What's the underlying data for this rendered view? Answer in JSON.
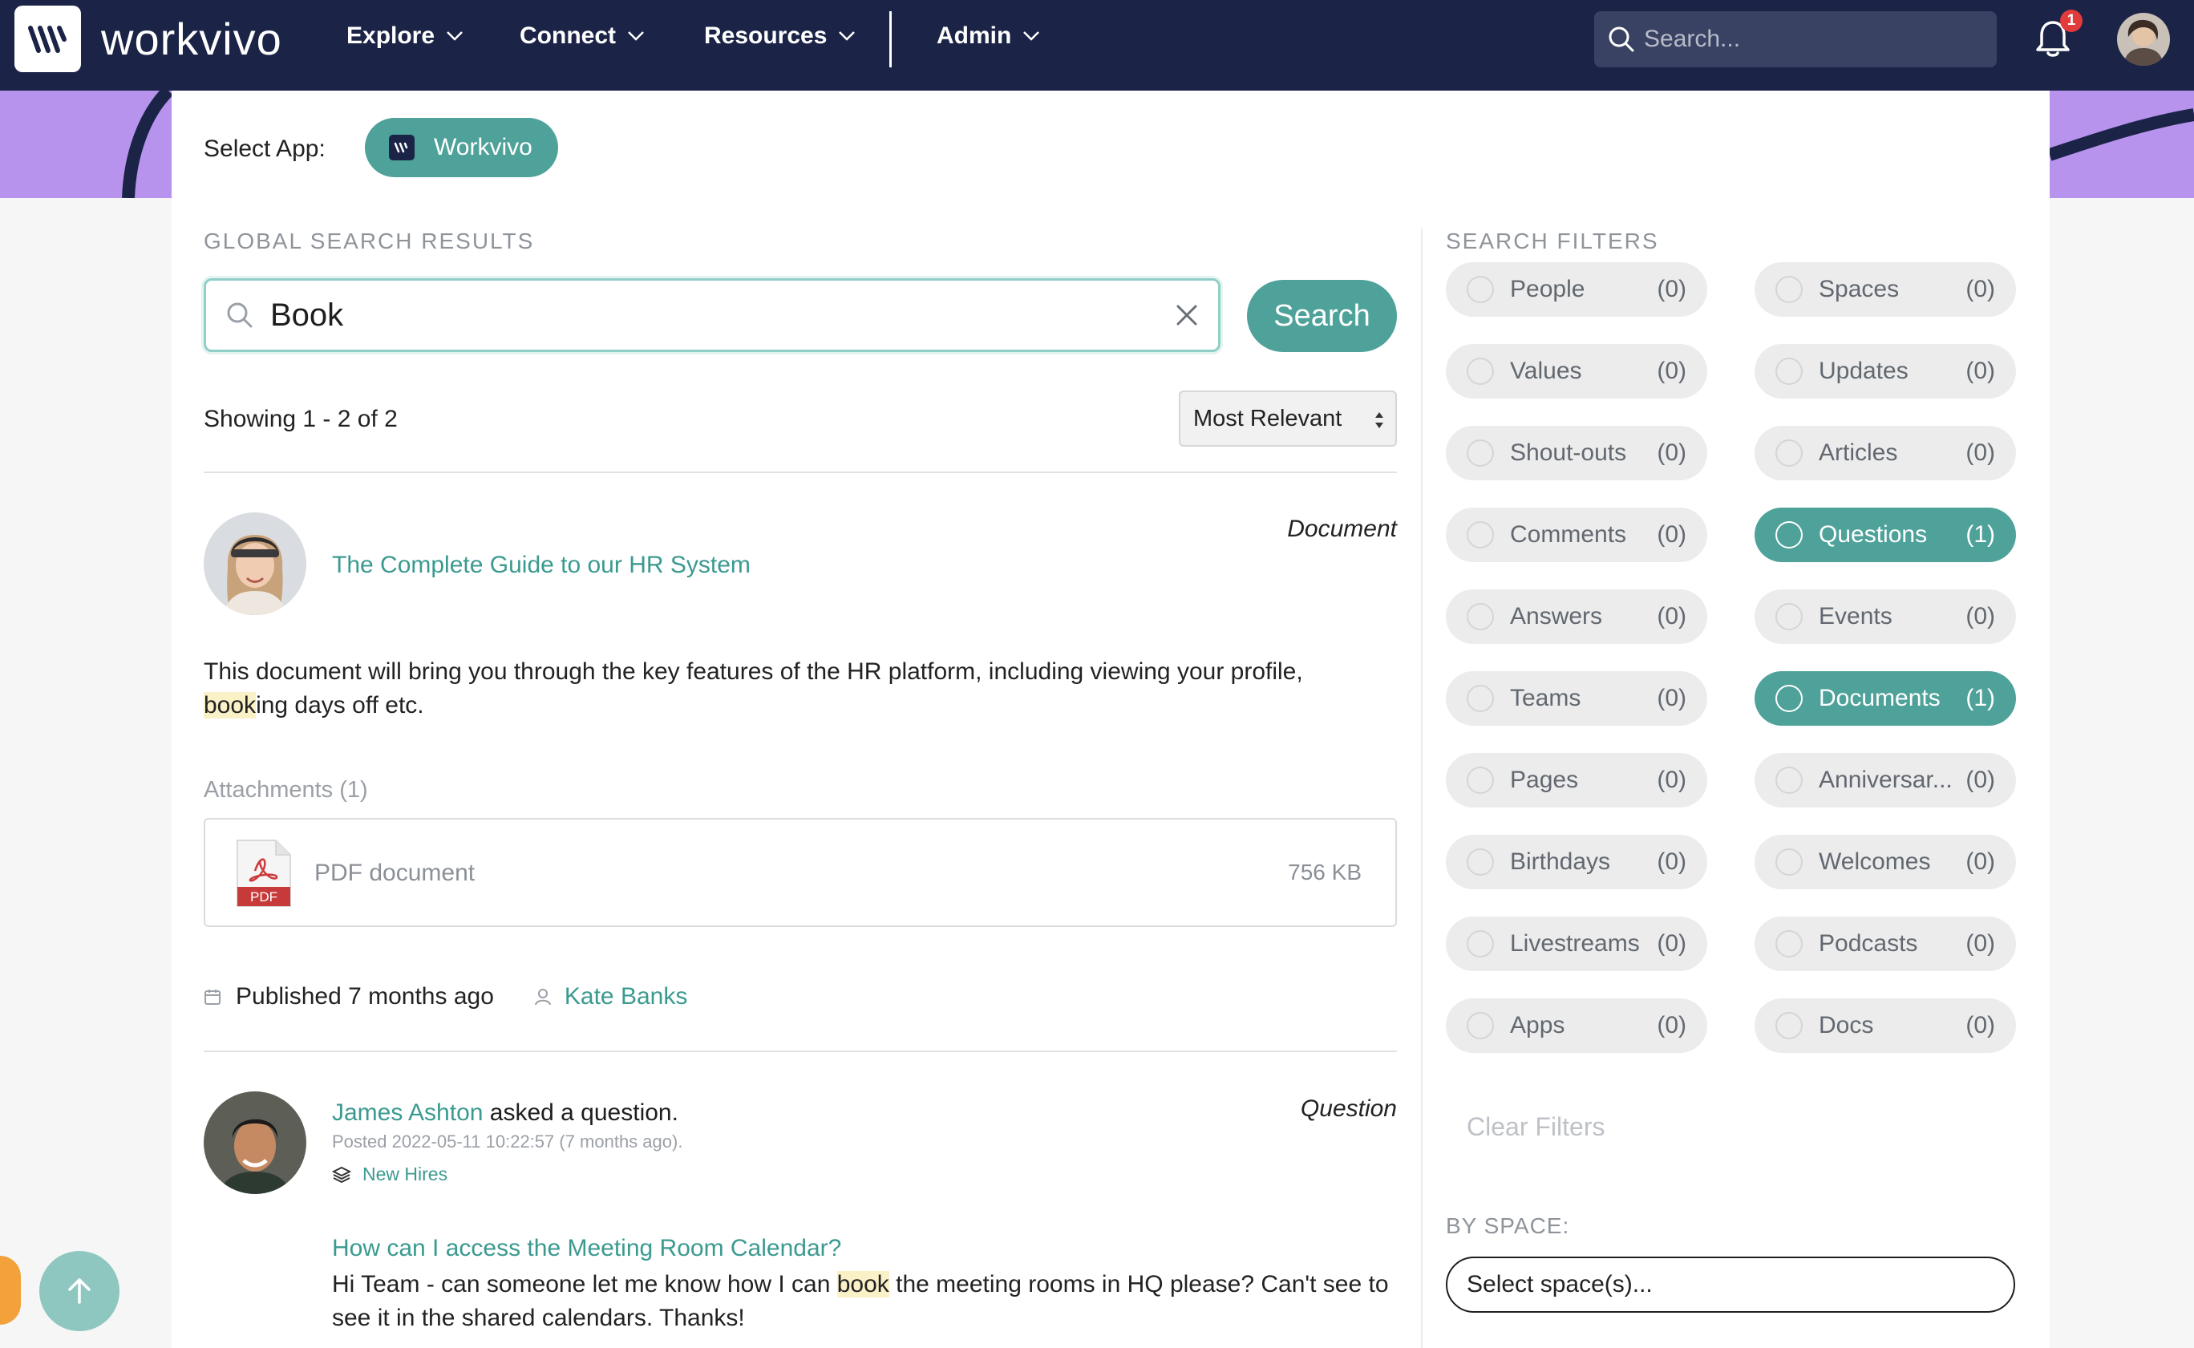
{
  "nav": {
    "brand": "workvivo",
    "items": [
      {
        "label": "Explore"
      },
      {
        "label": "Connect"
      },
      {
        "label": "Resources"
      },
      {
        "label": "Admin"
      }
    ],
    "search_placeholder": "Search...",
    "notifications_count": "1"
  },
  "app_select": {
    "label": "Select App:",
    "selected": "Workvivo"
  },
  "results": {
    "section_title": "GLOBAL SEARCH RESULTS",
    "query": "Book",
    "search_button": "Search",
    "showing": "Showing 1 - 2 of 2",
    "sort": "Most Relevant",
    "items": [
      {
        "type": "Document",
        "title": "The Complete Guide to our HR System",
        "body_before": "This document will bring you through the key features of the HR platform, including viewing your profile,",
        "body_highlight": "book",
        "body_after": "ing days off etc.",
        "attachments_label": "Attachments (1)",
        "attachment_name": "PDF document",
        "attachment_badge": "PDF",
        "attachment_size": "756 KB",
        "published": "Published 7 months ago",
        "author": "Kate Banks"
      },
      {
        "type": "Question",
        "author": "James Ashton",
        "action": " asked a question.",
        "posted": "Posted 2022-05-11 10:22:57 (7 months ago).",
        "space": "New Hires",
        "title": "How can I access the Meeting Room Calendar?",
        "body_before": "Hi Team - can someone let me know how I can ",
        "body_highlight": "book",
        "body_after": " the meeting rooms in HQ please? Can't see to",
        "body_line2": "see it in the shared calendars. Thanks!"
      }
    ]
  },
  "filters": {
    "section_title": "SEARCH FILTERS",
    "left": [
      {
        "label": "People",
        "count": "(0)",
        "active": false
      },
      {
        "label": "Values",
        "count": "(0)",
        "active": false
      },
      {
        "label": "Shout-outs",
        "count": "(0)",
        "active": false
      },
      {
        "label": "Comments",
        "count": "(0)",
        "active": false
      },
      {
        "label": "Answers",
        "count": "(0)",
        "active": false
      },
      {
        "label": "Teams",
        "count": "(0)",
        "active": false
      },
      {
        "label": "Pages",
        "count": "(0)",
        "active": false
      },
      {
        "label": "Birthdays",
        "count": "(0)",
        "active": false
      },
      {
        "label": "Livestreams",
        "count": "(0)",
        "active": false
      },
      {
        "label": "Apps",
        "count": "(0)",
        "active": false
      }
    ],
    "right": [
      {
        "label": "Spaces",
        "count": "(0)",
        "active": false
      },
      {
        "label": "Updates",
        "count": "(0)",
        "active": false
      },
      {
        "label": "Articles",
        "count": "(0)",
        "active": false
      },
      {
        "label": "Questions",
        "count": "(1)",
        "active": true
      },
      {
        "label": "Events",
        "count": "(0)",
        "active": false
      },
      {
        "label": "Documents",
        "count": "(1)",
        "active": true
      },
      {
        "label": "Anniversar...",
        "count": "(0)",
        "active": false
      },
      {
        "label": "Welcomes",
        "count": "(0)",
        "active": false
      },
      {
        "label": "Podcasts",
        "count": "(0)",
        "active": false
      },
      {
        "label": "Docs",
        "count": "(0)",
        "active": false
      }
    ],
    "clear_label": "Clear Filters",
    "by_space_label": "BY SPACE:",
    "space_placeholder": "Select space(s)..."
  },
  "colors": {
    "nav_bg": "#1b2447",
    "accent": "#4ea29a",
    "banner": "#b793ee",
    "highlight": "#fbf1c7"
  }
}
